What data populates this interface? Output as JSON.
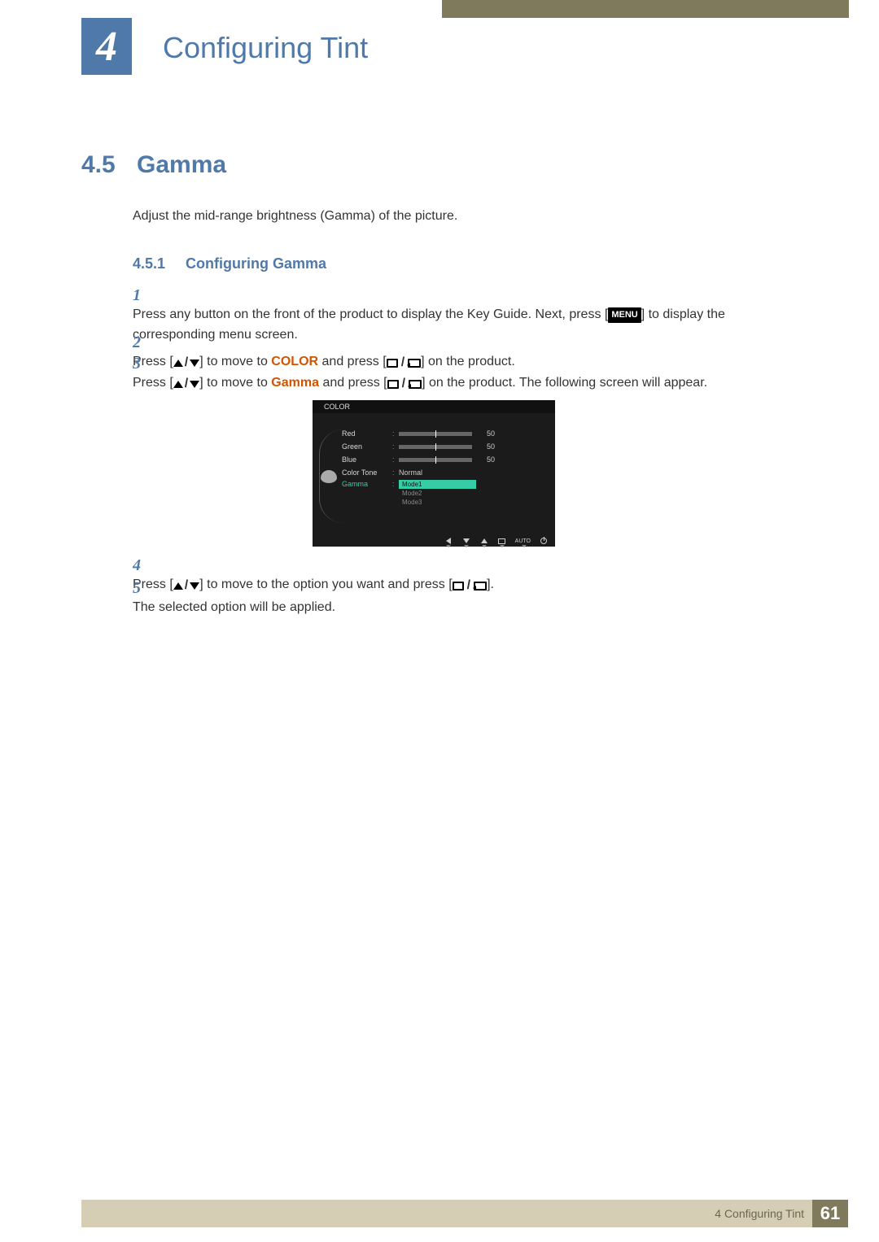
{
  "chapter": {
    "number": "4",
    "title": "Configuring Tint"
  },
  "section": {
    "number": "4.5",
    "title": "Gamma",
    "description": "Adjust the mid-range brightness (Gamma) of the picture."
  },
  "subsection": {
    "number": "4.5.1",
    "title": "Configuring Gamma"
  },
  "steps": {
    "s1": {
      "num": "1",
      "text_a": "Press any button on the front of the product to display the Key Guide. Next, press [",
      "menu": "MENU",
      "text_b": "] to display the corresponding menu screen."
    },
    "s2": {
      "num": "2",
      "text_a": "Press [",
      "text_b": "] to move to ",
      "color": "COLOR",
      "text_c": " and press [",
      "text_d": "] on the product."
    },
    "s3": {
      "num": "3",
      "text_a": "Press [",
      "text_b": "] to move to ",
      "gamma": "Gamma",
      "text_c": " and press [",
      "text_d": "] on the product. The following screen will appear."
    },
    "s4": {
      "num": "4",
      "text_a": "Press [",
      "text_b": "] to move to the option you want and press [",
      "text_c": "]."
    },
    "s5": {
      "num": "5",
      "text": "The selected option will be applied."
    }
  },
  "osd": {
    "title": "COLOR",
    "rows": {
      "red": {
        "label": "Red",
        "value": "50"
      },
      "green": {
        "label": "Green",
        "value": "50"
      },
      "blue": {
        "label": "Blue",
        "value": "50"
      },
      "colortone": {
        "label": "Color Tone",
        "value": "Normal"
      },
      "gamma": {
        "label": "Gamma",
        "options": [
          "Mode1",
          "Mode2",
          "Mode3"
        ],
        "selected": "Mode1"
      }
    },
    "footer": {
      "auto": "AUTO"
    }
  },
  "footer": {
    "chapter_ref": "4 Configuring Tint",
    "page": "61"
  }
}
